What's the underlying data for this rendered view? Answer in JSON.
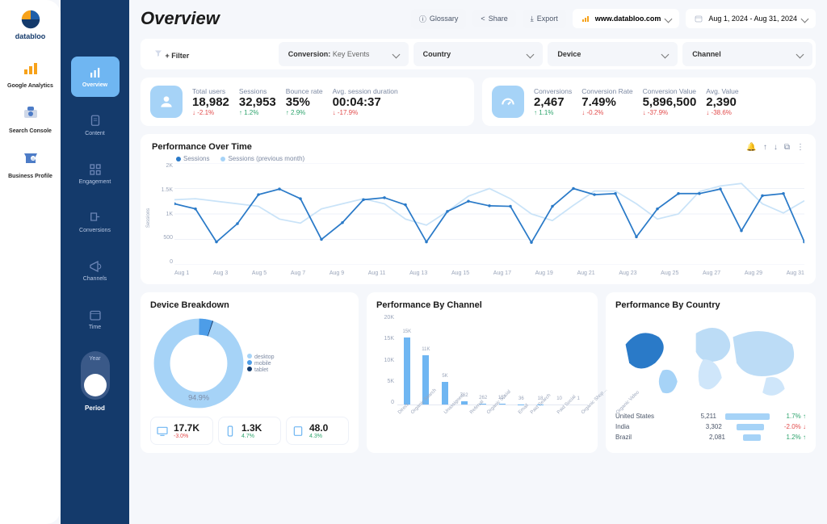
{
  "brand": "databloo",
  "leftRail": [
    {
      "name": "ga",
      "label": "Google Analytics"
    },
    {
      "name": "sc",
      "label": "Search Console"
    },
    {
      "name": "bp",
      "label": "Business Profile"
    }
  ],
  "midRail": [
    {
      "name": "overview",
      "label": "Overview"
    },
    {
      "name": "content",
      "label": "Content"
    },
    {
      "name": "engagement",
      "label": "Engagement"
    },
    {
      "name": "conversions",
      "label": "Conversions"
    },
    {
      "name": "channels",
      "label": "Channels"
    },
    {
      "name": "time",
      "label": "Time"
    }
  ],
  "midToggle": {
    "top": "Year",
    "bottom": "Period"
  },
  "header": {
    "title": "Overview",
    "glossary": "Glossary",
    "share": "Share",
    "export": "Export",
    "site": "www.databloo.com",
    "dateRange": "Aug 1, 2024 - Aug 31, 2024"
  },
  "filters": {
    "addLabel": "+ Filter",
    "items": [
      {
        "k": "Conversion:",
        "v": "Key Events"
      },
      {
        "k": "Country",
        "v": ""
      },
      {
        "k": "Device",
        "v": ""
      },
      {
        "k": "Channel",
        "v": ""
      }
    ]
  },
  "kpiA": [
    {
      "label": "Total users",
      "value": "18,982",
      "delta": "-2.1%",
      "dir": "down"
    },
    {
      "label": "Sessions",
      "value": "32,953",
      "delta": "1.2%",
      "dir": "up"
    },
    {
      "label": "Bounce rate",
      "value": "35%",
      "delta": "2.9%",
      "dir": "up"
    },
    {
      "label": "Avg. session duration",
      "value": "00:04:37",
      "delta": "-17.9%",
      "dir": "down"
    }
  ],
  "kpiB": [
    {
      "label": "Conversions",
      "value": "2,467",
      "delta": "1.1%",
      "dir": "up"
    },
    {
      "label": "Conversion Rate",
      "value": "7.49%",
      "delta": "-0.2%",
      "dir": "down"
    },
    {
      "label": "Conversion Value",
      "value": "5,896,500",
      "delta": "-37.9%",
      "dir": "down"
    },
    {
      "label": "Avg. Value",
      "value": "2,390",
      "delta": "-38.6%",
      "dir": "down"
    }
  ],
  "perfChart": {
    "title": "Performance Over Time",
    "yticks": [
      "2K",
      "1.5K",
      "1K",
      "500",
      "0"
    ],
    "ylabel": "Sessions",
    "legend": [
      "Sessions",
      "Sessions (previous month)"
    ],
    "xticks": [
      "Aug 1",
      "Aug 3",
      "Aug 5",
      "Aug 7",
      "Aug 9",
      "Aug 11",
      "Aug 13",
      "Aug 15",
      "Aug 17",
      "Aug 19",
      "Aug 21",
      "Aug 23",
      "Aug 25",
      "Aug 27",
      "Aug 29",
      "Aug 31"
    ]
  },
  "devicePanel": {
    "title": "Device Breakdown",
    "donutLabel": "94.9%",
    "legend": [
      "desktop",
      "mobile",
      "tablet"
    ],
    "stats": [
      {
        "value": "17.7K",
        "delta": "-3.0%",
        "dir": "down"
      },
      {
        "value": "1.3K",
        "delta": "4.7%",
        "dir": "up"
      },
      {
        "value": "48.0",
        "delta": "4.3%",
        "dir": "up"
      }
    ]
  },
  "channelPanel": {
    "title": "Performance By Channel",
    "yticks": [
      "20K",
      "15K",
      "10K",
      "5K",
      "0"
    ]
  },
  "countryPanel": {
    "title": "Performance By Country",
    "rows": [
      {
        "name": "United States",
        "val": "5,211",
        "pct": "1.7%",
        "dir": "up",
        "bar": 100
      },
      {
        "name": "India",
        "val": "3,302",
        "pct": "-2.0%",
        "dir": "down",
        "bar": 63
      },
      {
        "name": "Brazil",
        "val": "2,081",
        "pct": "1.2%",
        "dir": "up",
        "bar": 40
      }
    ]
  },
  "chart_data": [
    {
      "type": "line",
      "title": "Performance Over Time",
      "xlabel": "",
      "ylabel": "Sessions",
      "ylim": [
        0,
        2000
      ],
      "x": [
        "Aug 1",
        "Aug 2",
        "Aug 3",
        "Aug 4",
        "Aug 5",
        "Aug 6",
        "Aug 7",
        "Aug 8",
        "Aug 9",
        "Aug 10",
        "Aug 11",
        "Aug 12",
        "Aug 13",
        "Aug 14",
        "Aug 15",
        "Aug 16",
        "Aug 17",
        "Aug 18",
        "Aug 19",
        "Aug 20",
        "Aug 21",
        "Aug 22",
        "Aug 23",
        "Aug 24",
        "Aug 25",
        "Aug 26",
        "Aug 27",
        "Aug 28",
        "Aug 29",
        "Aug 30",
        "Aug 31"
      ],
      "series": [
        {
          "name": "Sessions",
          "values": [
            1200,
            1100,
            450,
            810,
            1380,
            1490,
            1300,
            500,
            830,
            1280,
            1320,
            1180,
            450,
            1050,
            1250,
            1160,
            1150,
            440,
            1150,
            1500,
            1380,
            1400,
            550,
            1100,
            1400,
            1400,
            1490,
            670,
            1360,
            1400,
            450
          ]
        },
        {
          "name": "Sessions (previous month)",
          "values": [
            1280,
            1300,
            1250,
            1200,
            1150,
            900,
            820,
            1100,
            1200,
            1300,
            1200,
            900,
            780,
            1050,
            1350,
            1500,
            1300,
            1000,
            870,
            1170,
            1450,
            1450,
            1200,
            900,
            1000,
            1440,
            1550,
            1600,
            1200,
            1020,
            1260
          ]
        }
      ]
    },
    {
      "type": "pie",
      "title": "Device Breakdown",
      "categories": [
        "desktop",
        "mobile",
        "tablet"
      ],
      "values": [
        94.9,
        4.8,
        0.3
      ]
    },
    {
      "type": "bar",
      "title": "Performance By Channel",
      "xlabel": "",
      "ylabel": "",
      "ylim": [
        0,
        20000
      ],
      "categories": [
        "Direct",
        "Organic Search",
        "Unassigned",
        "Referral",
        "Organic Social",
        "Email",
        "Paid Search",
        "Paid Social",
        "Organic Shop…",
        "Organic Video"
      ],
      "values": [
        15000,
        11000,
        5000,
        762,
        262,
        157,
        36,
        18,
        10,
        1
      ],
      "value_labels": [
        "15K",
        "11K",
        "5K",
        "762",
        "262",
        "157",
        "36",
        "18",
        "10",
        "1"
      ]
    }
  ]
}
